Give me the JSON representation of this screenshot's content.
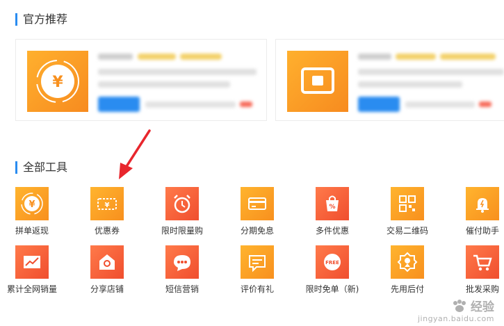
{
  "sections": {
    "recommend_title": "官方推荐",
    "tools_title": "全部工具"
  },
  "tools_row1": [
    {
      "label": "拼单返现",
      "icon": "coin-icon"
    },
    {
      "label": "优惠券",
      "icon": "coupon-icon"
    },
    {
      "label": "限时限量购",
      "icon": "alarm-clock-icon"
    },
    {
      "label": "分期免息",
      "icon": "credit-card-icon"
    },
    {
      "label": "多件优惠",
      "icon": "shopping-bag-icon"
    },
    {
      "label": "交易二维码",
      "icon": "qr-code-icon"
    },
    {
      "label": "催付助手",
      "icon": "bell-icon"
    }
  ],
  "tools_row2": [
    {
      "label": "累计全网销量",
      "icon": "trend-chart-icon"
    },
    {
      "label": "分享店铺",
      "icon": "store-icon"
    },
    {
      "label": "短信营销",
      "icon": "message-icon"
    },
    {
      "label": "评价有礼",
      "icon": "comment-icon"
    },
    {
      "label": "限时免单（新)",
      "icon": "free-badge-icon"
    },
    {
      "label": "先用后付",
      "icon": "medal-icon"
    },
    {
      "label": "批发采购",
      "icon": "cart-icon"
    }
  ],
  "free_badge_text": "FREE",
  "watermark": {
    "top": "经验",
    "bottom": "jingyan.baidu.com"
  },
  "colors": {
    "accent": "#2a8cf0",
    "orange": "#f8901e",
    "red": "#f04e2e",
    "arrow": "#e8262d"
  }
}
